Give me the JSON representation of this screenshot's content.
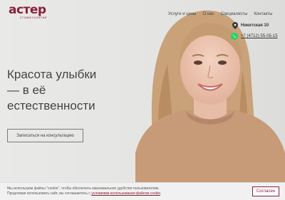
{
  "logo": {
    "word": "астер",
    "subtitle": "стоматология"
  },
  "nav": {
    "items": [
      "Услуги и цены",
      "О нас",
      "Специалисты",
      "Контакты"
    ]
  },
  "contacts": {
    "address": "Никитская 10",
    "phone": "+7 (4712) 55-05-15"
  },
  "hero": {
    "headline_line1": "Красота улыбки",
    "headline_line2": "— в её",
    "headline_line3": "естественности",
    "cta_label": "Записаться на консультацию"
  },
  "cookie": {
    "text_line1": "Мы используем файлы \"cookie\", чтобы обеспечить максимальное удобство пользователям.",
    "text_line2_prefix": "Продолжая использовать сайт, вы соглашаетесь с ",
    "link_text": "условиями использования файлов cookie",
    "text_line2_suffix": ".",
    "accept_label": "Согласен"
  },
  "colors": {
    "brand": "#8a1f3a",
    "whatsapp": "#25d366"
  },
  "icons": [
    "location-pin-icon",
    "whatsapp-icon"
  ]
}
